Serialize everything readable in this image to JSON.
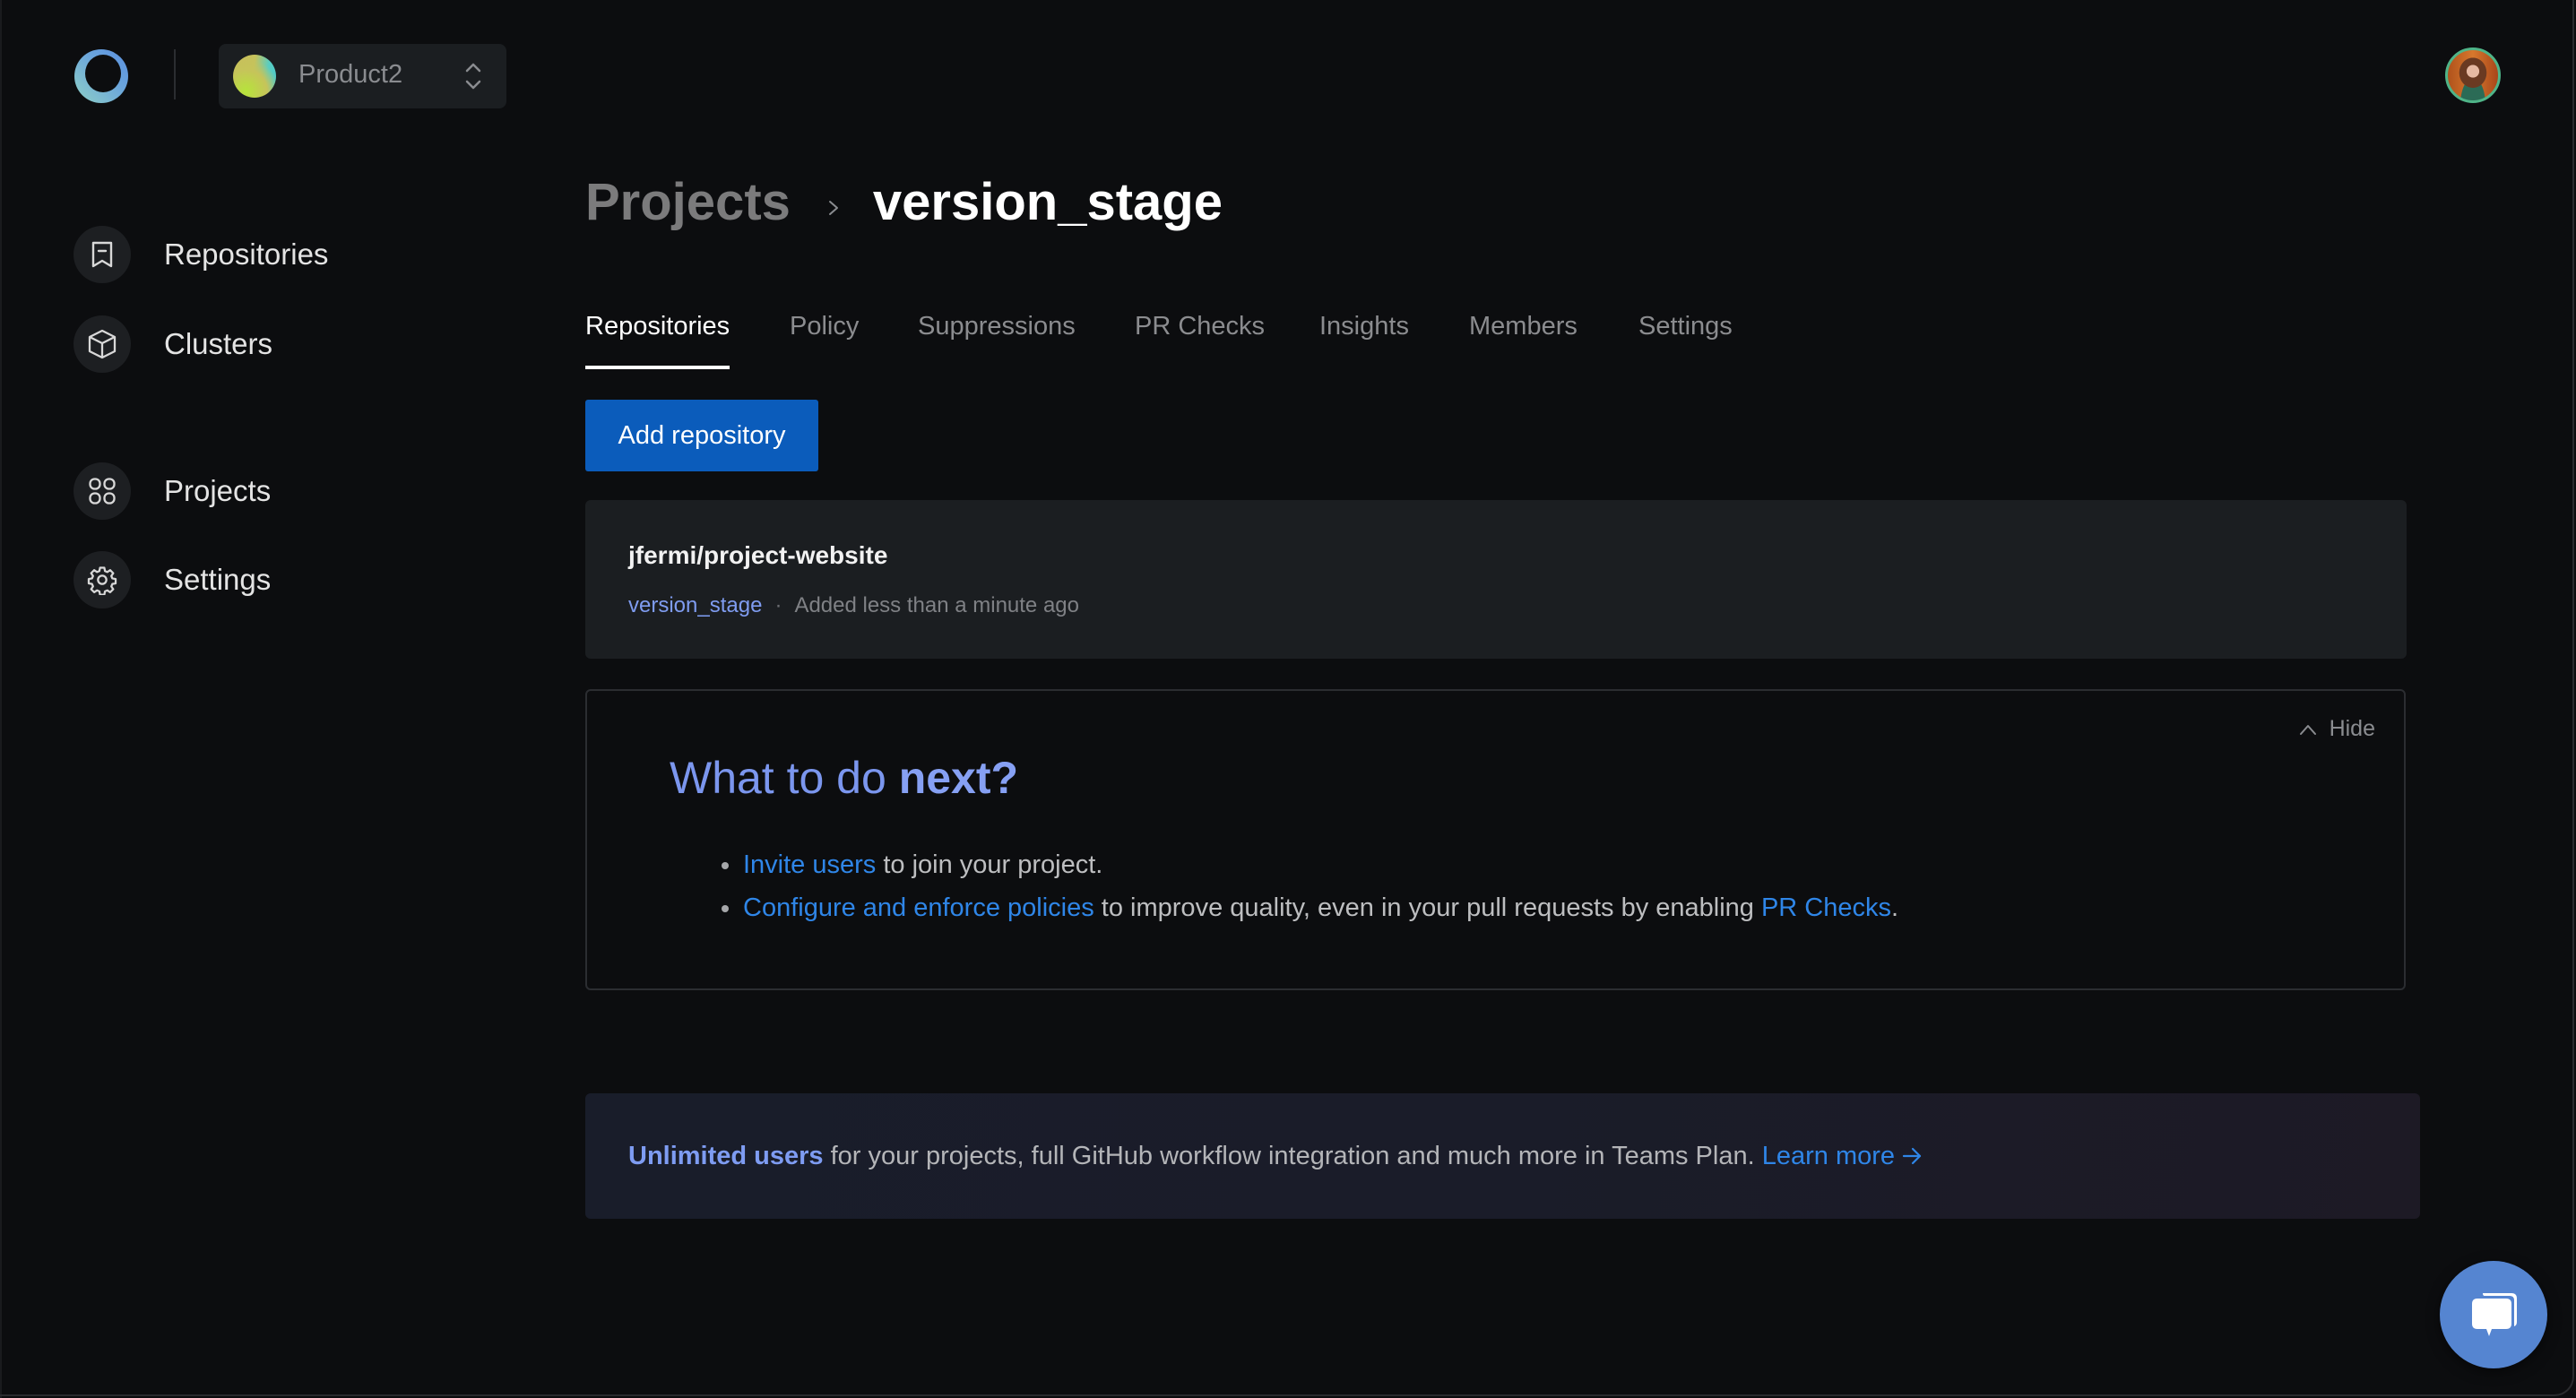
{
  "app": {
    "org_selector": {
      "name": "Product2"
    },
    "user": {
      "avatar_alt": "User avatar"
    }
  },
  "sidebar": {
    "items": [
      {
        "label": "Repositories",
        "icon": "repository-icon"
      },
      {
        "label": "Clusters",
        "icon": "cube-icon"
      },
      {
        "label": "Projects",
        "icon": "grid-icon"
      },
      {
        "label": "Settings",
        "icon": "gear-icon"
      }
    ]
  },
  "breadcrumb": {
    "parent": "Projects",
    "current": "version_stage"
  },
  "tabs": [
    {
      "label": "Repositories",
      "active": true
    },
    {
      "label": "Policy",
      "active": false
    },
    {
      "label": "Suppressions",
      "active": false
    },
    {
      "label": "PR Checks",
      "active": false
    },
    {
      "label": "Insights",
      "active": false
    },
    {
      "label": "Members",
      "active": false
    },
    {
      "label": "Settings",
      "active": false
    }
  ],
  "toolbar": {
    "add_repository_label": "Add repository"
  },
  "repositories": [
    {
      "name": "jfermi/project-website",
      "project": "version_stage",
      "separator": "·",
      "added": "Added less than a minute ago"
    }
  ],
  "next_steps": {
    "hide_label": "Hide",
    "title_prefix": "What to do ",
    "title_emphasis": "next?",
    "items": [
      {
        "link": "Invite users",
        "text": " to join your project."
      },
      {
        "link": "Configure and enforce policies",
        "text": " to improve quality, even in your pull requests by enabling ",
        "link2": "PR Checks",
        "suffix": "."
      }
    ]
  },
  "banner": {
    "strong": "Unlimited users",
    "text": " for your projects, full GitHub workflow integration and much more in Teams Plan. ",
    "link": "Learn more"
  },
  "colors": {
    "background": "#0c0d0f",
    "card": "#1b1e21",
    "primary_button": "#0b5cbb",
    "link": "#2f86e8",
    "accent_purple_blue": "#7b96ee",
    "chat_button": "#5585d1",
    "avatar_ring": "#4fb488"
  }
}
